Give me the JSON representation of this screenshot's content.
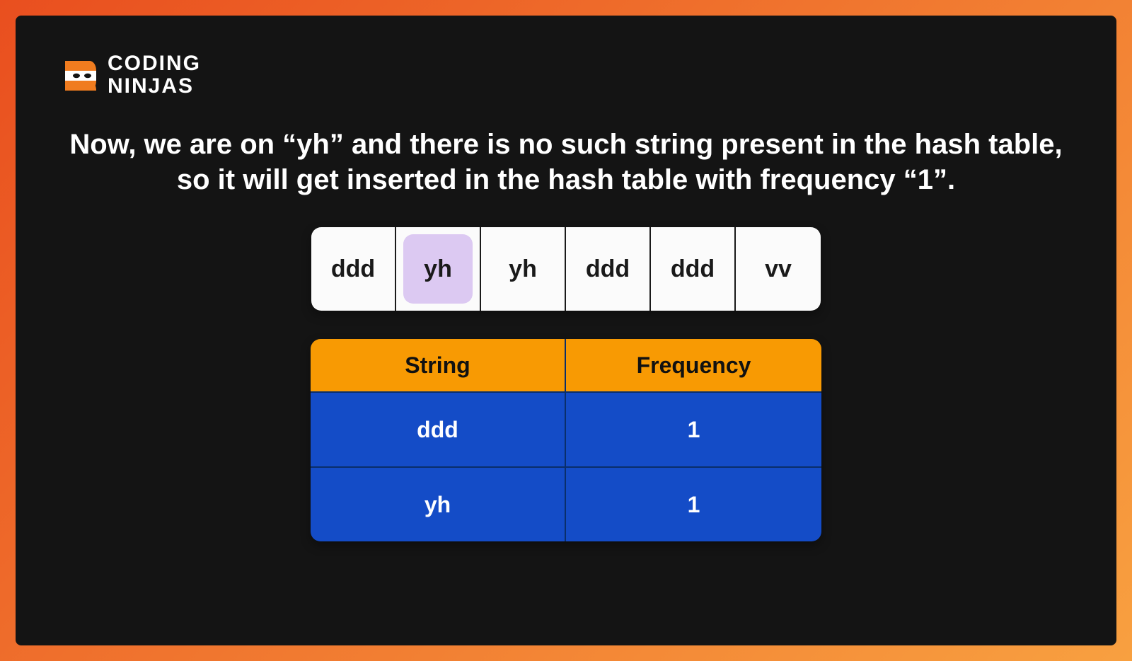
{
  "brand": {
    "line1": "CODING",
    "line2": "NINJAS"
  },
  "explain_text": "Now, we are on “yh” and there is no such string present in the hash table, so it will get inserted in the hash table with frequency “1”.",
  "array": {
    "items": [
      "ddd",
      "yh",
      "yh",
      "ddd",
      "ddd",
      "vv"
    ],
    "highlight_index": 1
  },
  "hash_table": {
    "headers": [
      "String",
      "Frequency"
    ],
    "rows": [
      {
        "string": "ddd",
        "frequency": "1"
      },
      {
        "string": "yh",
        "frequency": "1"
      }
    ]
  },
  "colors": {
    "frame_bg": "#141414",
    "accent_orange": "#f89a03",
    "accent_blue": "#144cc7",
    "highlight": "#dcc9f2"
  }
}
